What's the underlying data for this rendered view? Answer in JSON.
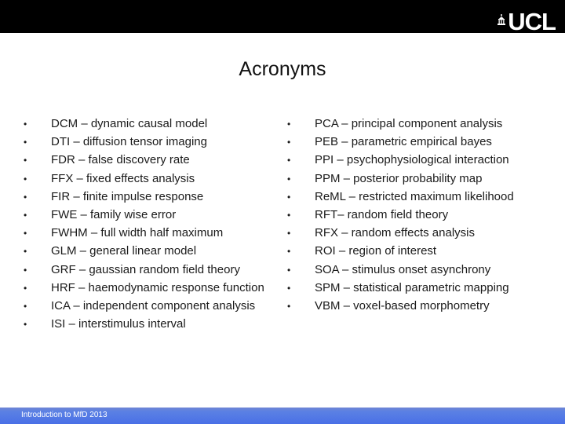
{
  "header": {
    "logo_text": "UCL",
    "logo_icon": "portico-building-icon",
    "bar_color": "#000000"
  },
  "slide": {
    "title": "Acronyms",
    "left_column": [
      {
        "acronym": "DCM",
        "text": "DCM – dynamic causal model"
      },
      {
        "acronym": "DTI",
        "text": "DTI – diffusion tensor imaging"
      },
      {
        "acronym": "FDR",
        "text": "FDR – false discovery rate"
      },
      {
        "acronym": "FFX",
        "text": "FFX – fixed effects analysis"
      },
      {
        "acronym": "FIR",
        "text": "FIR – finite impulse response"
      },
      {
        "acronym": "FWE",
        "text": "FWE – family wise error"
      },
      {
        "acronym": "FWHM",
        "text": "FWHM – full width half maximum"
      },
      {
        "acronym": "GLM",
        "text": "GLM – general linear model"
      },
      {
        "acronym": "GRF",
        "text": "GRF – gaussian random field theory"
      },
      {
        "acronym": "HRF",
        "text": "HRF – haemodynamic response function"
      },
      {
        "acronym": "ICA",
        "text": "ICA – independent component analysis"
      },
      {
        "acronym": "ISI",
        "text": "ISI – interstimulus interval"
      }
    ],
    "right_column": [
      {
        "acronym": "PCA",
        "text": "PCA – principal component analysis"
      },
      {
        "acronym": "PEB",
        "text": "PEB – parametric empirical bayes"
      },
      {
        "acronym": "PPI",
        "text": "PPI – psychophysiological interaction"
      },
      {
        "acronym": "PPM",
        "text": "PPM – posterior probability map"
      },
      {
        "acronym": "ReML",
        "text": "ReML – restricted maximum likelihood"
      },
      {
        "acronym": "RFT",
        "text": "RFT– random field theory"
      },
      {
        "acronym": "RFX",
        "text": "RFX – random effects analysis"
      },
      {
        "acronym": "ROI",
        "text": "ROI – region of interest"
      },
      {
        "acronym": "SOA",
        "text": "SOA – stimulus onset asynchrony"
      },
      {
        "acronym": "SPM",
        "text": "SPM – statistical parametric mapping"
      },
      {
        "acronym": "VBM",
        "text": "VBM – voxel-based morphometry"
      }
    ],
    "bullet": "•"
  },
  "footer": {
    "text": "Introduction to MfD 2013",
    "bar_color": "#4a70e6"
  }
}
